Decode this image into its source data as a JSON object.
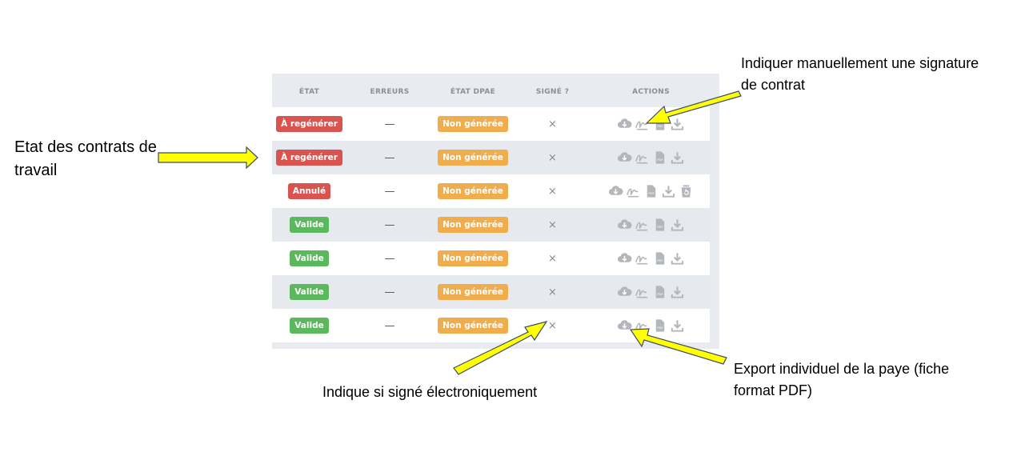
{
  "colors": {
    "danger": "#d9534f",
    "success": "#5cb85c",
    "warning": "#f0ad4e",
    "icon": "#b3b7bc",
    "arrow_fill": "#ffff00"
  },
  "table": {
    "headers": {
      "etat": "ÉTAT",
      "erreurs": "ERREURS",
      "etat_dpae": "ÉTAT DPAE",
      "signe": "SIGNÉ ?",
      "actions": "ACTIONS"
    },
    "rows": [
      {
        "etat": "À regénérer",
        "etat_color": "danger",
        "erreurs": "—",
        "dpae": "Non générée",
        "signe": "×",
        "actions": [
          "cloud-download-icon",
          "signature-icon",
          "pdf-icon",
          "download-icon"
        ]
      },
      {
        "etat": "À regénérer",
        "etat_color": "danger",
        "erreurs": "—",
        "dpae": "Non générée",
        "signe": "×",
        "actions": [
          "cloud-download-icon",
          "signature-icon",
          "pdf-icon",
          "download-icon"
        ]
      },
      {
        "etat": "Annulé",
        "etat_color": "danger",
        "erreurs": "—",
        "dpae": "Non générée",
        "signe": "×",
        "actions": [
          "cloud-download-icon",
          "signature-icon",
          "pdf-icon",
          "download-icon",
          "trash-restore-icon"
        ]
      },
      {
        "etat": "Valide",
        "etat_color": "success",
        "erreurs": "—",
        "dpae": "Non générée",
        "signe": "×",
        "actions": [
          "cloud-download-icon",
          "signature-icon",
          "pdf-icon",
          "download-icon"
        ]
      },
      {
        "etat": "Valide",
        "etat_color": "success",
        "erreurs": "—",
        "dpae": "Non générée",
        "signe": "×",
        "actions": [
          "cloud-download-icon",
          "signature-icon",
          "pdf-icon",
          "download-icon"
        ]
      },
      {
        "etat": "Valide",
        "etat_color": "success",
        "erreurs": "—",
        "dpae": "Non générée",
        "signe": "×",
        "actions": [
          "cloud-download-icon",
          "signature-icon",
          "pdf-icon",
          "download-icon"
        ]
      },
      {
        "etat": "Valide",
        "etat_color": "success",
        "erreurs": "—",
        "dpae": "Non générée",
        "signe": "×",
        "actions": [
          "cloud-download-icon",
          "signature-icon",
          "pdf-icon",
          "download-icon"
        ]
      }
    ]
  },
  "annotations": {
    "etat_contrats": "Etat des contrats de travail",
    "signature_manuelle": "Indiquer manuellement une signature de contrat",
    "signe_electronique": "Indique si signé électroniquement",
    "export_paye": "Export individuel de la paye (fiche format PDF)"
  }
}
